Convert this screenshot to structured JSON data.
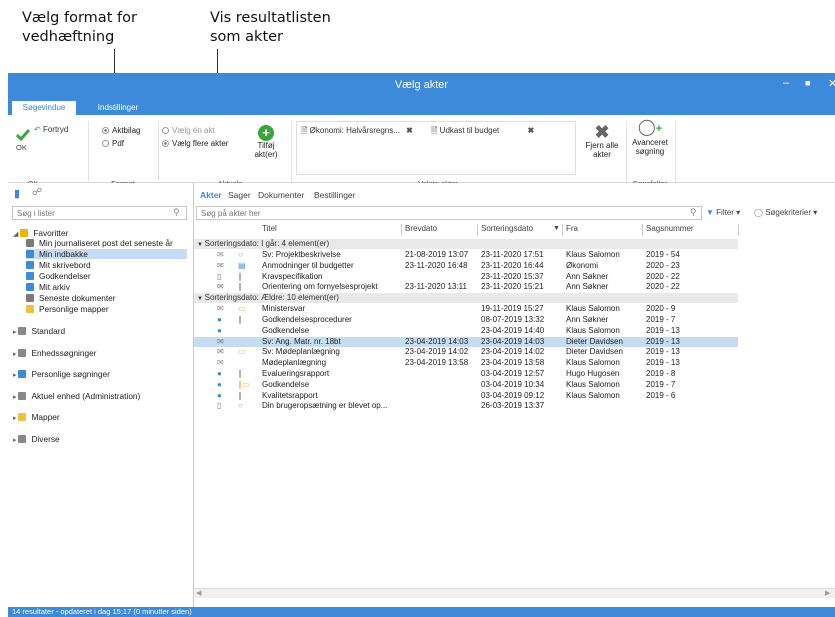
{
  "callouts": [
    {
      "lines": [
        "Vælg format for",
        "vedhæftning"
      ]
    },
    {
      "lines": [
        "Vis resultatlisten",
        "som akter"
      ]
    }
  ],
  "window": {
    "title": "Vælg akter"
  },
  "ribbon_tabs": [
    {
      "label": "Søgevindue",
      "active": true
    },
    {
      "label": "Indstillinger",
      "active": false
    }
  ],
  "ribbon": {
    "ok": "OK",
    "fortryd": "Fortryd",
    "format_options": [
      "Aktbilag",
      "Pdf"
    ],
    "aktvalg_options": [
      "Vælg én akt",
      "Vælg flere akter"
    ],
    "tilfoj": [
      "Tilføj",
      "akt(er)"
    ],
    "selected_chips": [
      "Økonomi: Halvårsregns...",
      "Udkast til budget"
    ],
    "fjern": [
      "Fjern alle",
      "akter"
    ],
    "avanceret": [
      "Avanceret",
      "søgning"
    ],
    "groups": {
      "ok": "OK",
      "format": "Format",
      "aktvalg": "Aktvalg",
      "valgte": "Valgte akter",
      "sogefelter": "Søgefelter"
    }
  },
  "left": {
    "search_placeholder": "Søg i lister",
    "items": [
      {
        "label": "Favoritter",
        "level": 0,
        "icon": "star-icon"
      },
      {
        "label": "Min journaliseret post det seneste år",
        "level": 1,
        "icon": "document-icon"
      },
      {
        "label": "Min indbakke",
        "level": 1,
        "icon": "inbox-icon",
        "selected": true
      },
      {
        "label": "Mit skrivebord",
        "level": 1,
        "icon": "desk-icon"
      },
      {
        "label": "Godkendelser",
        "level": 1,
        "icon": "check-icon"
      },
      {
        "label": "Mit arkiv",
        "level": 1,
        "icon": "archive-icon"
      },
      {
        "label": "Seneste dokumenter",
        "level": 1,
        "icon": "recent-icon"
      },
      {
        "label": "Personlige mapper",
        "level": 1,
        "icon": "folder-icon"
      },
      {
        "label": "Standard",
        "level": 0,
        "icon": "calendar-icon"
      },
      {
        "label": "Enhedssøgninger",
        "level": 0,
        "icon": "unit-icon"
      },
      {
        "label": "Personlige søgninger",
        "level": 0,
        "icon": "person-icon"
      },
      {
        "label": "Aktuel enhed (Administration)",
        "level": 0,
        "icon": "unit-icon"
      },
      {
        "label": "Mapper",
        "level": 0,
        "icon": "folder-icon"
      },
      {
        "label": "Diverse",
        "level": 0,
        "icon": "misc-icon"
      }
    ]
  },
  "main": {
    "tabs": [
      {
        "label": "Akter",
        "active": true
      },
      {
        "label": "Sager"
      },
      {
        "label": "Dokumenter"
      },
      {
        "label": "Bestillinger"
      }
    ],
    "search_placeholder": "Søg på akter her",
    "filter": "Filter",
    "sogekriterier": "Søgekriterier",
    "columns": [
      "Titel",
      "Brevdato",
      "Sorteringsdato",
      "Fra",
      "Sagsnummer"
    ],
    "groups": [
      {
        "label": "Sorteringsdato: I går: 4 element(er)",
        "rows": [
          {
            "icon": "mail-reply-icon",
            "extra": "comment-icon",
            "title": "Sv: Projektbeskrivelse",
            "brevdato": "21-08-2019 13:07",
            "sort": "23-11-2020 17:51",
            "fra": "Klaus Salomon",
            "sag": "2019 - 54"
          },
          {
            "icon": "mail-icon",
            "extra": "doc-blue-icon",
            "title": "Anmodninger til budgetter",
            "brevdato": "23-11-2020 16:48",
            "sort": "23-11-2020 16:44",
            "fra": "Økonomi",
            "sag": "2020 - 23"
          },
          {
            "icon": "document-icon",
            "extra": "attachment-icon",
            "title": "Kravspecifikation",
            "brevdato": "",
            "sort": "23-11-2020 15:37",
            "fra": "Ann Søkner",
            "sag": "2020 - 22"
          },
          {
            "icon": "mail-icon",
            "extra": "attachment-icon",
            "title": "Orientering om fornyelsesprojekt",
            "brevdato": "23-11-2020 13:11",
            "sort": "23-11-2020 15:21",
            "fra": "Ann Søkner",
            "sag": "2020 - 22"
          }
        ]
      },
      {
        "label": "Sorteringsdato: Ældre: 10 element(er)",
        "rows": [
          {
            "icon": "mail-reply-icon",
            "extra": "folder-outline-icon",
            "title": "Ministersvar",
            "brevdato": "",
            "sort": "19-11-2019 15:27",
            "fra": "Klaus Salomon",
            "sag": "2020 - 9"
          },
          {
            "icon": "approval-pending-icon",
            "extra": "attachment-icon",
            "title": "Godkendelsesprocedurer",
            "brevdato": "",
            "sort": "08-07-2019 13:32",
            "fra": "Ann Søkner",
            "sag": "2019 - 7"
          },
          {
            "icon": "approval-done-icon",
            "extra": "",
            "title": "Godkendelse",
            "brevdato": "",
            "sort": "23-04-2019 14:40",
            "fra": "Klaus Salomon",
            "sag": "2019 - 13"
          },
          {
            "icon": "mail-icon",
            "extra": "",
            "title": "Sv: Ang. Matr. nr. 18bt",
            "brevdato": "23-04-2019 14:03",
            "sort": "23-04-2019 14:03",
            "fra": "Dieter Davidsen",
            "sag": "2019 - 13",
            "selected": true
          },
          {
            "icon": "mail-icon",
            "extra": "folder-outline-icon",
            "title": "Sv: Mødeplanlægning",
            "brevdato": "23-04-2019 14:02",
            "sort": "23-04-2019 14:02",
            "fra": "Dieter Davidsen",
            "sag": "2019 - 13"
          },
          {
            "icon": "mail-reply-icon",
            "extra": "",
            "title": "Mødeplanlægning",
            "brevdato": "23-04-2019 13:58",
            "sort": "23-04-2019 13:58",
            "fra": "Klaus Salomon",
            "sag": "2019 - 13"
          },
          {
            "icon": "approval-pending-icon",
            "extra": "attachment-icon",
            "title": "Evalueringsrapport",
            "brevdato": "",
            "sort": "03-04-2019 12:57",
            "fra": "Hugo Hugosen",
            "sag": "2019 - 8"
          },
          {
            "icon": "approval-done-icon",
            "extra": "attachment-folder-icon",
            "title": "Godkendelse",
            "brevdato": "",
            "sort": "03-04-2019 10:34",
            "fra": "Klaus Salomon",
            "sag": "2019 - 7"
          },
          {
            "icon": "approval-pending-icon",
            "extra": "attachment-icon",
            "title": "Kvalitetsrapport",
            "brevdato": "",
            "sort": "03-04-2019 09:12",
            "fra": "Klaus Salomon",
            "sag": "2019 - 6"
          },
          {
            "icon": "document-icon",
            "extra": "comment-icon",
            "title": "Din brugeropsætning er blevet op...",
            "brevdato": "",
            "sort": "26-03-2019 13:37",
            "fra": "",
            "sag": ""
          }
        ]
      }
    ]
  },
  "status": "14 resultater - opdateret i dag 15:17 (0 minutter siden)",
  "colors": {
    "accent": "#3c8ad9",
    "selection": "#c7dcf2",
    "ok_green": "#3aa63a"
  }
}
